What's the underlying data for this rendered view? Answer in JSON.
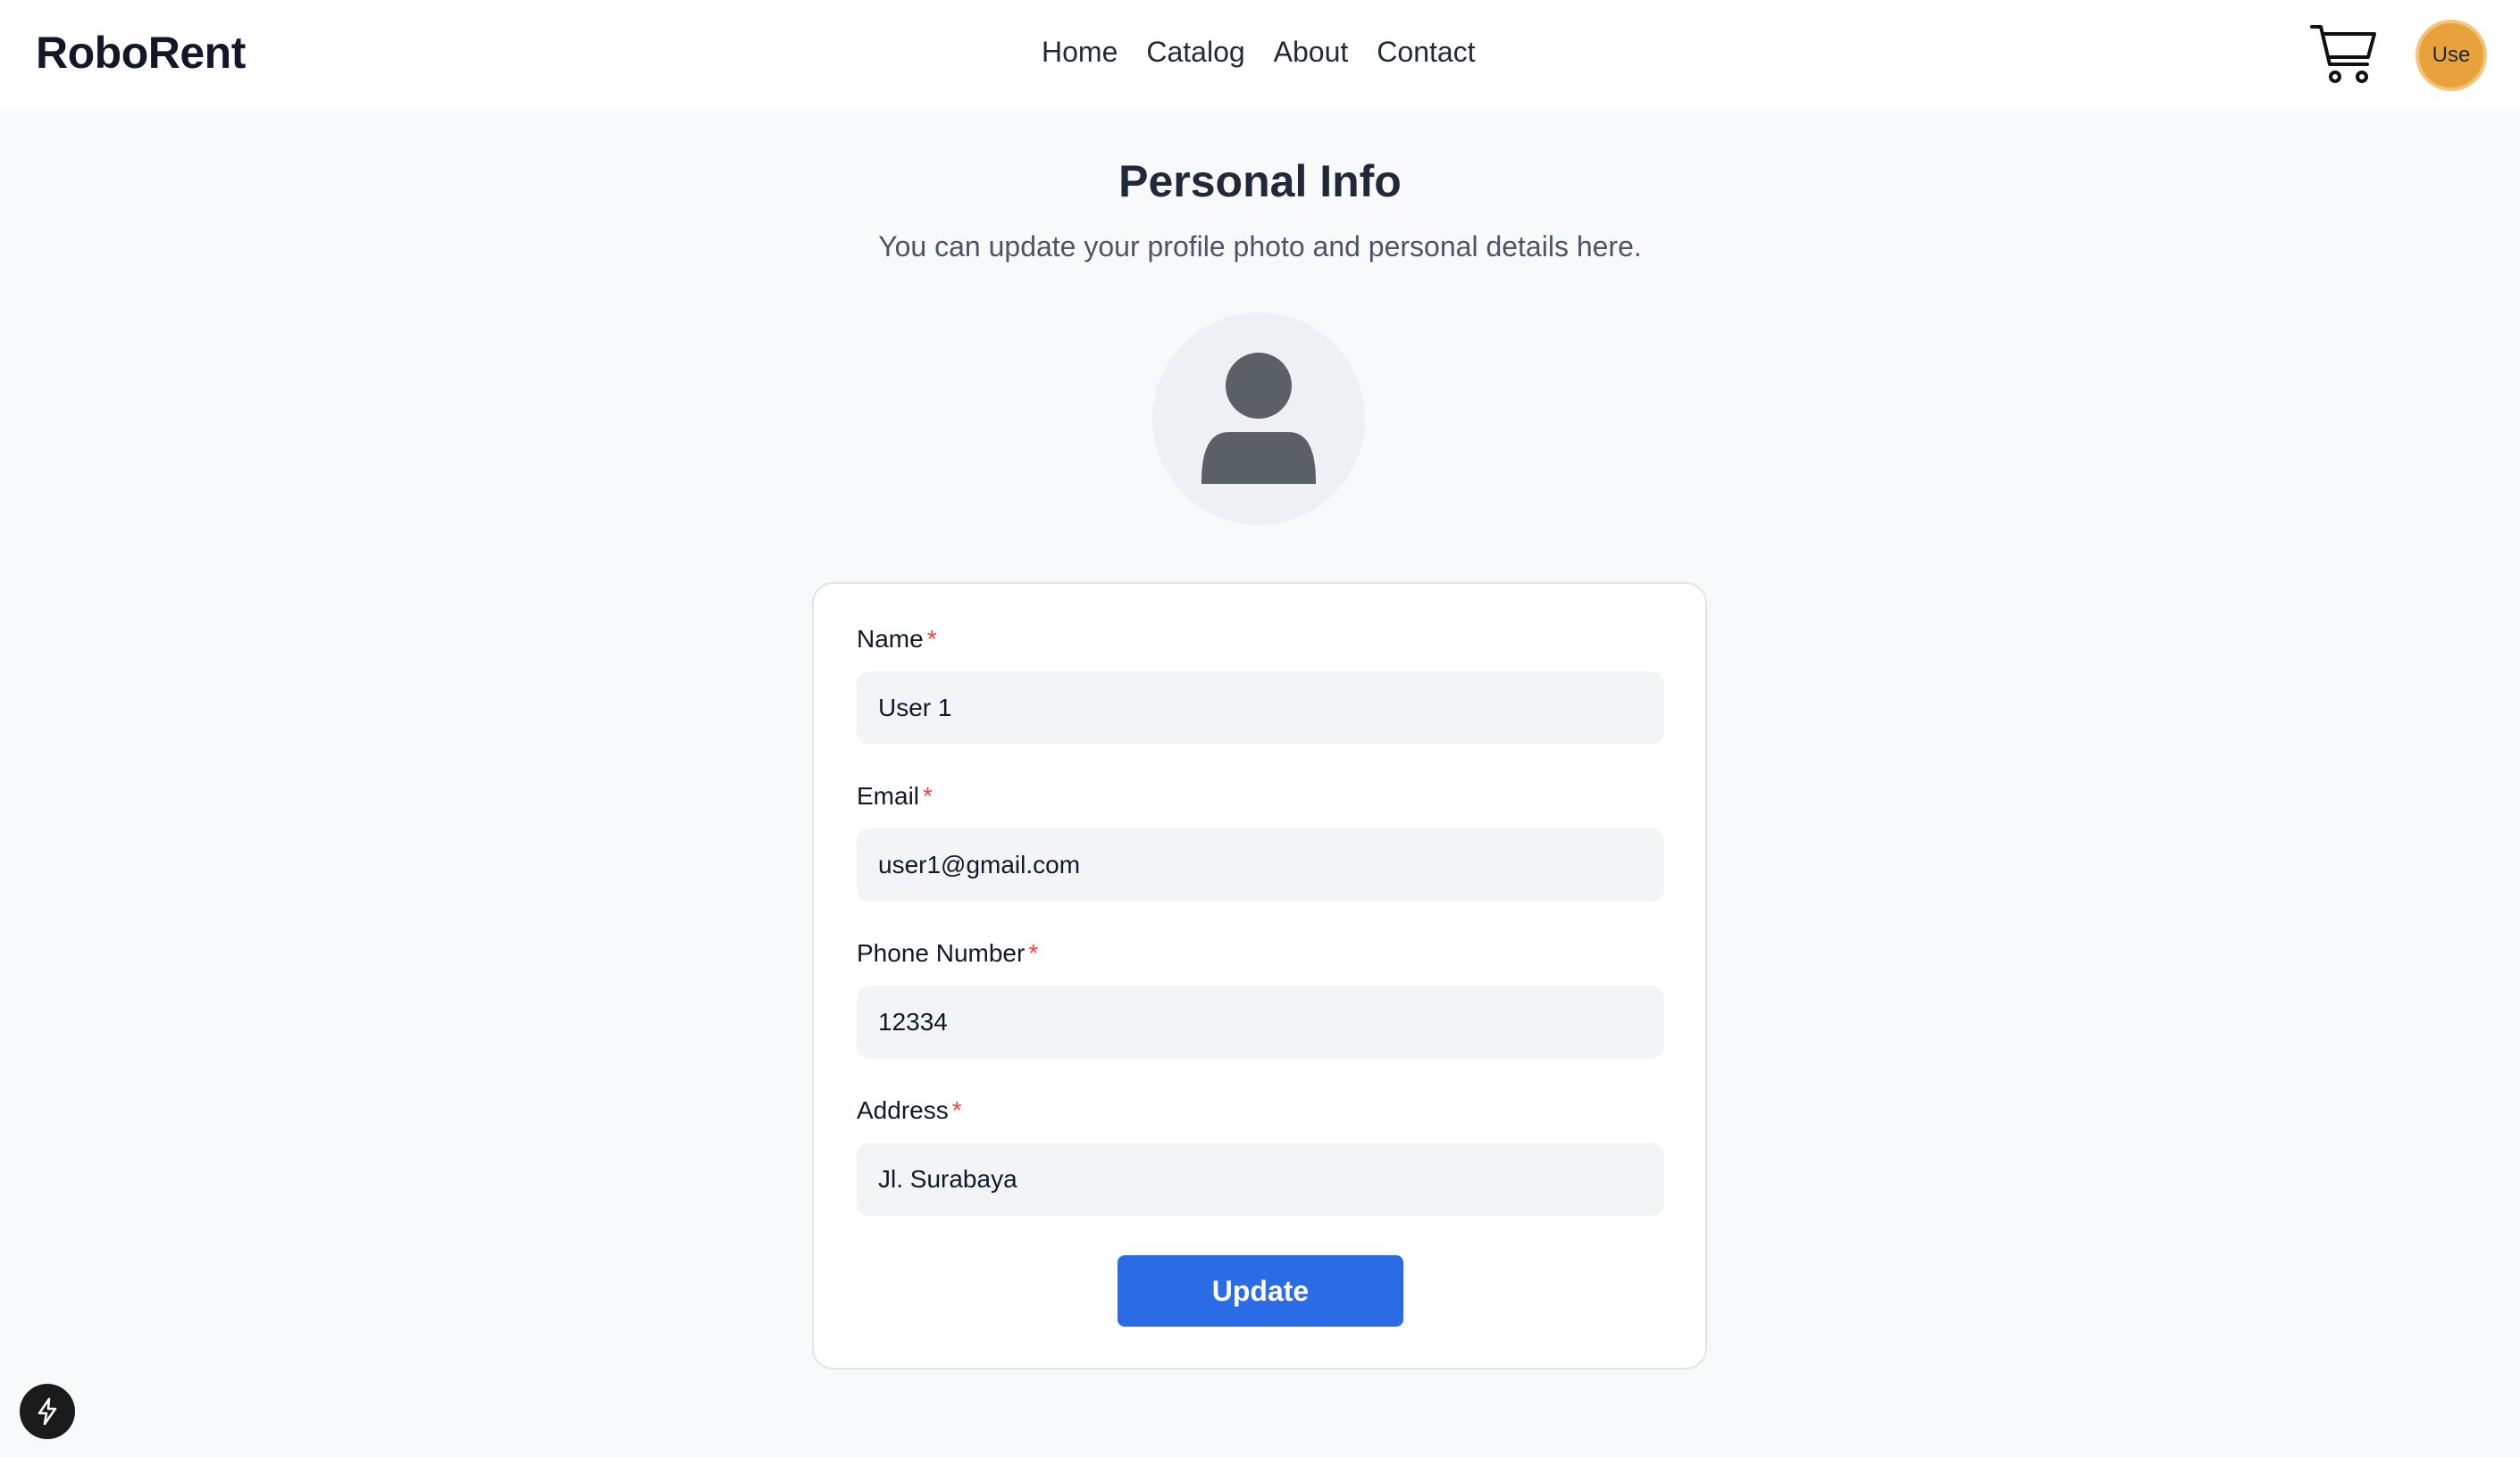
{
  "brand": "RoboRent",
  "nav": {
    "links": [
      {
        "label": "Home"
      },
      {
        "label": "Catalog"
      },
      {
        "label": "About"
      },
      {
        "label": "Contact"
      }
    ]
  },
  "header": {
    "cart_icon": "cart-icon",
    "avatar_text": "Use",
    "avatar_color": "#e9a23b"
  },
  "page": {
    "title": "Personal Info",
    "subtitle": "You can update your profile photo and personal details here."
  },
  "profile_photo": {
    "icon": "user-placeholder-icon"
  },
  "form": {
    "required_marker": "*",
    "name": {
      "label": "Name",
      "value": "User 1"
    },
    "email": {
      "label": "Email",
      "value": "user1@gmail.com"
    },
    "phone": {
      "label": "Phone Number",
      "value": "12334"
    },
    "address": {
      "label": "Address",
      "value": "Jl. Surabaya"
    },
    "submit_label": "Update"
  },
  "colors": {
    "primary": "#2b6be6",
    "required": "#ef4444",
    "background": "#f8f9fb"
  },
  "devtools": {
    "icon": "lightning-icon"
  }
}
